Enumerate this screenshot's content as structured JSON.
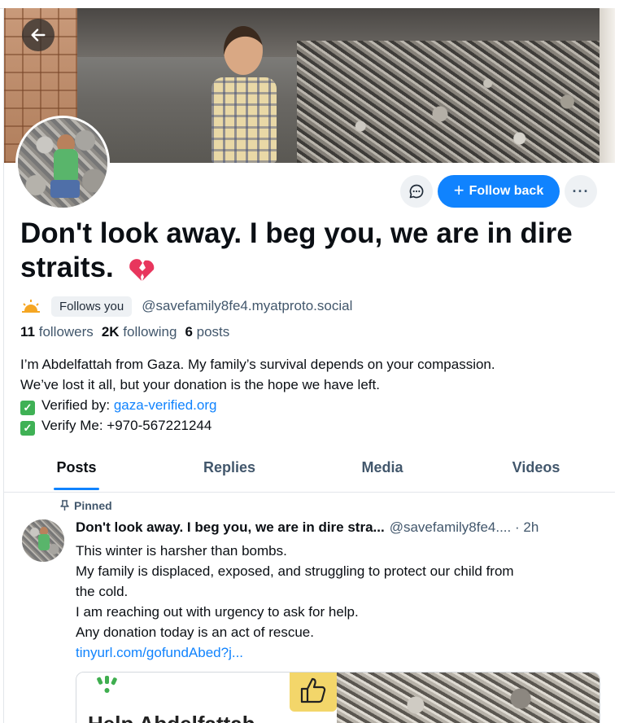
{
  "profile": {
    "display_name": "Don't look away. I beg you, we are in dire straits.",
    "follows_you": "Follows you",
    "handle": "@savefamily8fe4.myatproto.social",
    "followers_count": "11",
    "followers_label": "followers",
    "following_count": "2K",
    "following_label": "following",
    "posts_count": "6",
    "posts_label": "posts"
  },
  "actions": {
    "follow_label": "Follow back",
    "more": "···"
  },
  "bio": {
    "line1": "I’m Abdelfattah from Gaza. My family’s survival depends on your compassion.",
    "line2": "We’ve lost it all, but your donation is the hope we have left.",
    "verified_prefix": "Verified by: ",
    "verified_link": "gaza-verified.org",
    "verify_me": "Verify Me: +970-567221244"
  },
  "tabs": [
    {
      "label": "Posts",
      "active": true
    },
    {
      "label": "Replies",
      "active": false
    },
    {
      "label": "Media",
      "active": false
    },
    {
      "label": "Videos",
      "active": false
    }
  ],
  "post": {
    "pinned_label": "Pinned",
    "author": "Don't look away. I beg you, we are in dire stra...",
    "handle": "@savefamily8fe4....",
    "time": "· 2h",
    "lines": [
      "This winter is harsher than bombs.",
      "My family is displaced, exposed, and struggling to protect our child from",
      "the cold.",
      "I am reaching out with urgency to ask for help.",
      "Any donation today is an act of rescue."
    ],
    "link": "tinyurl.com/gofundAbed?j...",
    "embed_title": "Help Abdelfattah"
  },
  "colors": {
    "accent": "#1083fe",
    "muted": "#42576c",
    "verified": "#3fb155"
  },
  "icons": {
    "back": "arrow-left-icon",
    "message": "chat-bubble-icon",
    "more": "ellipsis-icon",
    "sun": "sunrise-icon",
    "heart": "broken-heart-icon",
    "pin": "pin-icon",
    "check": "check-box-icon"
  }
}
